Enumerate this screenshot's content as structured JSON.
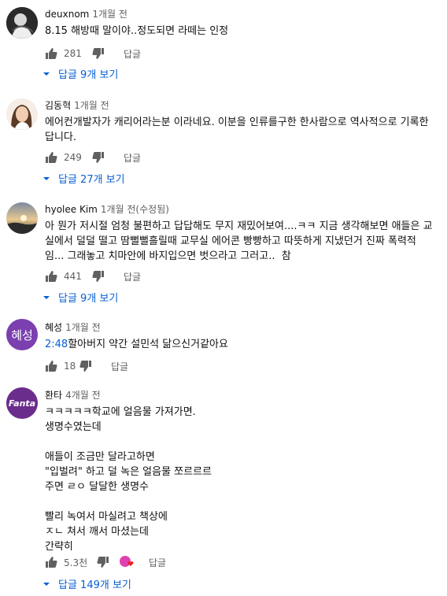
{
  "comments": [
    {
      "author": "deuxnom",
      "time": "1개월 전",
      "text": "8.15 해방때 말이야..정도되면 라떼는 인정",
      "likes": "281",
      "reply_label": "답글",
      "replies_label": "답글 9개 보기"
    },
    {
      "author": "김동혁",
      "time": "1개월 전",
      "text": "에어컨개발자가 캐리어라는분 이라네요. 이분을 인류를구한 한사람으로 역사적으로 기록한\n답니다.",
      "likes": "249",
      "reply_label": "답글",
      "replies_label": "답글 27개 보기"
    },
    {
      "author": "hyolee Kim",
      "time": "1개월 전(수정됨)",
      "text": "아 뭔가 저시절 엄청 불편하고 답답해도 무지 재밌어보여....ㅋㅋ 지금 생각해보면 애들은 교\n실에서 덜덜 떨고 땀뻘뻘흘릴때 교무실 에어콘 빵빵하고 따뜻하게 지냈던거 진짜 폭력적\n임... 그래놓고 치마안에 바지입으면 벗으라고 그러고..  참",
      "likes": "441",
      "reply_label": "답글",
      "replies_label": "답글 9개 보기"
    },
    {
      "author": "혜성",
      "avatar_text": "혜성",
      "time": "1개월 전",
      "timestamp": "2:48",
      "text": "할아버지 약간 설민석 닮으신거같아요",
      "likes": "18",
      "reply_label": "답글"
    },
    {
      "author": "환타",
      "avatar_text": "Fanta",
      "time": "4개월 전",
      "text": "ㅋㅋㅋㅋㅋ학교에 얼음물 가져가면.\n생명수였는데\n\n애들이 조금만 달라고하면\n\"입벌려\" 하고 덜 녹은 얼음물 쪼르르르\n주면 ㄹㅇ 달달한 생명수\n\n빨리 녹여서 마실려고 책상에\nㅈㄴ 쳐서 깨서 마셨는데\n간략히",
      "likes": "5.3천",
      "reply_label": "답글",
      "replies_label": "답글 149개 보기"
    }
  ],
  "colors": {
    "link": "#065fd4",
    "muted": "#606060",
    "text": "#0f0f0f"
  }
}
